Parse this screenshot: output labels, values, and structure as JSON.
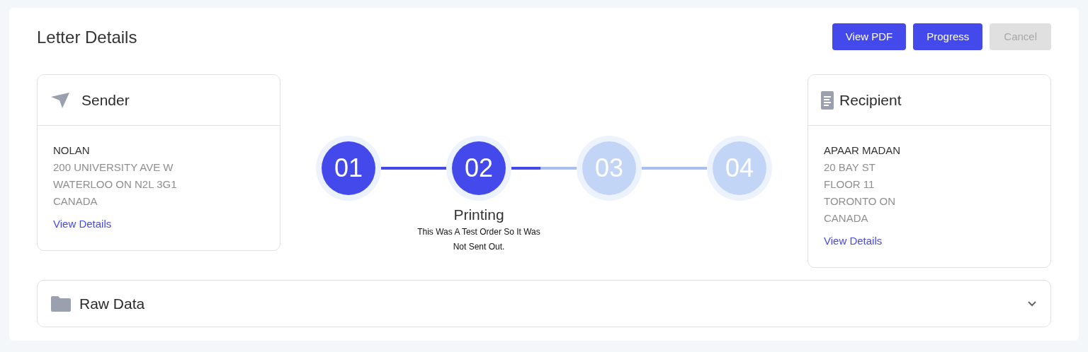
{
  "title": "Letter Details",
  "buttons": [
    {
      "label": "View PDF",
      "disabled": false
    },
    {
      "label": "Progress",
      "disabled": false
    },
    {
      "label": "Cancel",
      "disabled": true
    }
  ],
  "sender": {
    "heading": "Sender",
    "name": "NOLAN",
    "lines": [
      "200 UNIVERSITY AVE W",
      "WATERLOO ON N2L 3G1",
      "CANADA"
    ],
    "link": "View Details"
  },
  "steps": [
    {
      "number": "01",
      "done": true
    },
    {
      "number": "02",
      "done": true,
      "label": "Printing",
      "description": "This Was A Test Order So It Was Not Sent Out."
    },
    {
      "number": "03",
      "done": false
    },
    {
      "number": "04",
      "done": false
    }
  ],
  "connectors": [
    {
      "level": 1
    },
    {
      "level": 0.45
    },
    {
      "level": 0
    }
  ],
  "recipient": {
    "heading": "Recipient",
    "name": "APAAR MADAN",
    "lines": [
      "20 BAY ST",
      "FLOOR 11",
      "TORONTO ON",
      "CANADA"
    ],
    "link": "View Details"
  },
  "raw_data": {
    "label": "Raw Data",
    "expanded": false
  }
}
